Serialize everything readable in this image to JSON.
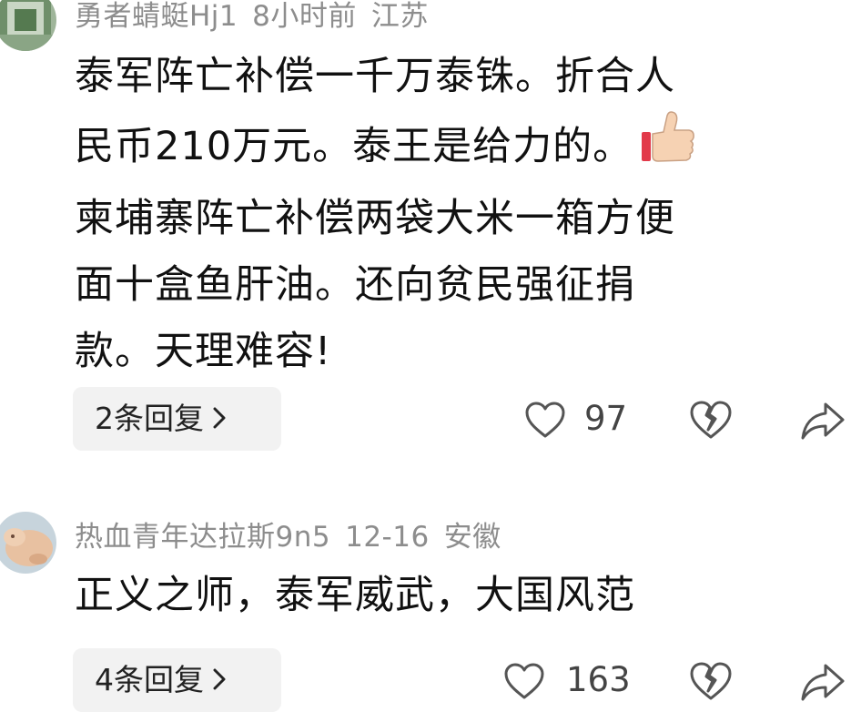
{
  "comments": [
    {
      "author": "勇者蜻蜓Hj1",
      "time": "8小时前",
      "location": "江苏",
      "lines": [
        "泰军阵亡补偿一千万泰铢。折合人",
        "民币210万元。泰王是给力的。",
        "柬埔寨阵亡补偿两袋大米一箱方便",
        "面十盒鱼肝油。还向贫民强征捐",
        "款。天理难容!"
      ],
      "emoji": "thumbs-up-icon",
      "replies_label": "2条回复",
      "likes": "97"
    },
    {
      "author": "热血青年达拉斯9n5",
      "time": "12-16",
      "location": "安徽",
      "lines": [
        "正义之师，泰军威武，大国风范"
      ],
      "replies_label": "4条回复",
      "likes": "163"
    }
  ],
  "colors": {
    "meta": "#8d8d8d",
    "text": "#111111",
    "reply_bg": "#f2f2f2",
    "icon": "#555555"
  }
}
